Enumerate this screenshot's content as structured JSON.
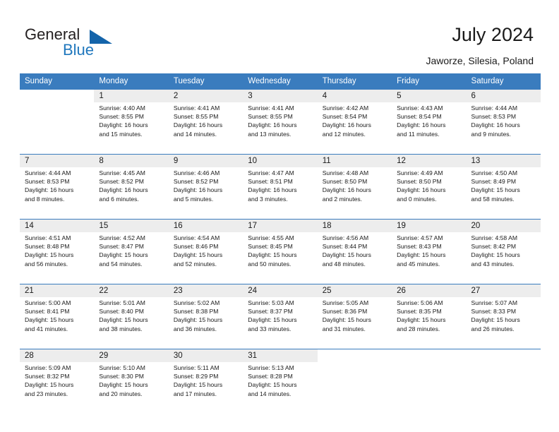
{
  "brand": {
    "name_top": "General",
    "name_bottom": "Blue",
    "accent_color": "#1f77bd",
    "triangle_color": "#1464aa"
  },
  "header": {
    "title": "July 2024",
    "subtitle": "Jaworze, Silesia, Poland"
  },
  "calendar": {
    "header_bg": "#3a7cbe",
    "daynum_bg": "#ededed",
    "columns": [
      "Sunday",
      "Monday",
      "Tuesday",
      "Wednesday",
      "Thursday",
      "Friday",
      "Saturday"
    ],
    "weeks": [
      [
        {
          "day": "",
          "sunrise": "",
          "sunset": "",
          "daylight_line1": "",
          "daylight_line2": ""
        },
        {
          "day": "1",
          "sunrise": "Sunrise: 4:40 AM",
          "sunset": "Sunset: 8:55 PM",
          "daylight_line1": "Daylight: 16 hours",
          "daylight_line2": "and 15 minutes."
        },
        {
          "day": "2",
          "sunrise": "Sunrise: 4:41 AM",
          "sunset": "Sunset: 8:55 PM",
          "daylight_line1": "Daylight: 16 hours",
          "daylight_line2": "and 14 minutes."
        },
        {
          "day": "3",
          "sunrise": "Sunrise: 4:41 AM",
          "sunset": "Sunset: 8:55 PM",
          "daylight_line1": "Daylight: 16 hours",
          "daylight_line2": "and 13 minutes."
        },
        {
          "day": "4",
          "sunrise": "Sunrise: 4:42 AM",
          "sunset": "Sunset: 8:54 PM",
          "daylight_line1": "Daylight: 16 hours",
          "daylight_line2": "and 12 minutes."
        },
        {
          "day": "5",
          "sunrise": "Sunrise: 4:43 AM",
          "sunset": "Sunset: 8:54 PM",
          "daylight_line1": "Daylight: 16 hours",
          "daylight_line2": "and 11 minutes."
        },
        {
          "day": "6",
          "sunrise": "Sunrise: 4:44 AM",
          "sunset": "Sunset: 8:53 PM",
          "daylight_line1": "Daylight: 16 hours",
          "daylight_line2": "and 9 minutes."
        }
      ],
      [
        {
          "day": "7",
          "sunrise": "Sunrise: 4:44 AM",
          "sunset": "Sunset: 8:53 PM",
          "daylight_line1": "Daylight: 16 hours",
          "daylight_line2": "and 8 minutes."
        },
        {
          "day": "8",
          "sunrise": "Sunrise: 4:45 AM",
          "sunset": "Sunset: 8:52 PM",
          "daylight_line1": "Daylight: 16 hours",
          "daylight_line2": "and 6 minutes."
        },
        {
          "day": "9",
          "sunrise": "Sunrise: 4:46 AM",
          "sunset": "Sunset: 8:52 PM",
          "daylight_line1": "Daylight: 16 hours",
          "daylight_line2": "and 5 minutes."
        },
        {
          "day": "10",
          "sunrise": "Sunrise: 4:47 AM",
          "sunset": "Sunset: 8:51 PM",
          "daylight_line1": "Daylight: 16 hours",
          "daylight_line2": "and 3 minutes."
        },
        {
          "day": "11",
          "sunrise": "Sunrise: 4:48 AM",
          "sunset": "Sunset: 8:50 PM",
          "daylight_line1": "Daylight: 16 hours",
          "daylight_line2": "and 2 minutes."
        },
        {
          "day": "12",
          "sunrise": "Sunrise: 4:49 AM",
          "sunset": "Sunset: 8:50 PM",
          "daylight_line1": "Daylight: 16 hours",
          "daylight_line2": "and 0 minutes."
        },
        {
          "day": "13",
          "sunrise": "Sunrise: 4:50 AM",
          "sunset": "Sunset: 8:49 PM",
          "daylight_line1": "Daylight: 15 hours",
          "daylight_line2": "and 58 minutes."
        }
      ],
      [
        {
          "day": "14",
          "sunrise": "Sunrise: 4:51 AM",
          "sunset": "Sunset: 8:48 PM",
          "daylight_line1": "Daylight: 15 hours",
          "daylight_line2": "and 56 minutes."
        },
        {
          "day": "15",
          "sunrise": "Sunrise: 4:52 AM",
          "sunset": "Sunset: 8:47 PM",
          "daylight_line1": "Daylight: 15 hours",
          "daylight_line2": "and 54 minutes."
        },
        {
          "day": "16",
          "sunrise": "Sunrise: 4:54 AM",
          "sunset": "Sunset: 8:46 PM",
          "daylight_line1": "Daylight: 15 hours",
          "daylight_line2": "and 52 minutes."
        },
        {
          "day": "17",
          "sunrise": "Sunrise: 4:55 AM",
          "sunset": "Sunset: 8:45 PM",
          "daylight_line1": "Daylight: 15 hours",
          "daylight_line2": "and 50 minutes."
        },
        {
          "day": "18",
          "sunrise": "Sunrise: 4:56 AM",
          "sunset": "Sunset: 8:44 PM",
          "daylight_line1": "Daylight: 15 hours",
          "daylight_line2": "and 48 minutes."
        },
        {
          "day": "19",
          "sunrise": "Sunrise: 4:57 AM",
          "sunset": "Sunset: 8:43 PM",
          "daylight_line1": "Daylight: 15 hours",
          "daylight_line2": "and 45 minutes."
        },
        {
          "day": "20",
          "sunrise": "Sunrise: 4:58 AM",
          "sunset": "Sunset: 8:42 PM",
          "daylight_line1": "Daylight: 15 hours",
          "daylight_line2": "and 43 minutes."
        }
      ],
      [
        {
          "day": "21",
          "sunrise": "Sunrise: 5:00 AM",
          "sunset": "Sunset: 8:41 PM",
          "daylight_line1": "Daylight: 15 hours",
          "daylight_line2": "and 41 minutes."
        },
        {
          "day": "22",
          "sunrise": "Sunrise: 5:01 AM",
          "sunset": "Sunset: 8:40 PM",
          "daylight_line1": "Daylight: 15 hours",
          "daylight_line2": "and 38 minutes."
        },
        {
          "day": "23",
          "sunrise": "Sunrise: 5:02 AM",
          "sunset": "Sunset: 8:38 PM",
          "daylight_line1": "Daylight: 15 hours",
          "daylight_line2": "and 36 minutes."
        },
        {
          "day": "24",
          "sunrise": "Sunrise: 5:03 AM",
          "sunset": "Sunset: 8:37 PM",
          "daylight_line1": "Daylight: 15 hours",
          "daylight_line2": "and 33 minutes."
        },
        {
          "day": "25",
          "sunrise": "Sunrise: 5:05 AM",
          "sunset": "Sunset: 8:36 PM",
          "daylight_line1": "Daylight: 15 hours",
          "daylight_line2": "and 31 minutes."
        },
        {
          "day": "26",
          "sunrise": "Sunrise: 5:06 AM",
          "sunset": "Sunset: 8:35 PM",
          "daylight_line1": "Daylight: 15 hours",
          "daylight_line2": "and 28 minutes."
        },
        {
          "day": "27",
          "sunrise": "Sunrise: 5:07 AM",
          "sunset": "Sunset: 8:33 PM",
          "daylight_line1": "Daylight: 15 hours",
          "daylight_line2": "and 26 minutes."
        }
      ],
      [
        {
          "day": "28",
          "sunrise": "Sunrise: 5:09 AM",
          "sunset": "Sunset: 8:32 PM",
          "daylight_line1": "Daylight: 15 hours",
          "daylight_line2": "and 23 minutes."
        },
        {
          "day": "29",
          "sunrise": "Sunrise: 5:10 AM",
          "sunset": "Sunset: 8:30 PM",
          "daylight_line1": "Daylight: 15 hours",
          "daylight_line2": "and 20 minutes."
        },
        {
          "day": "30",
          "sunrise": "Sunrise: 5:11 AM",
          "sunset": "Sunset: 8:29 PM",
          "daylight_line1": "Daylight: 15 hours",
          "daylight_line2": "and 17 minutes."
        },
        {
          "day": "31",
          "sunrise": "Sunrise: 5:13 AM",
          "sunset": "Sunset: 8:28 PM",
          "daylight_line1": "Daylight: 15 hours",
          "daylight_line2": "and 14 minutes."
        },
        {
          "day": "",
          "sunrise": "",
          "sunset": "",
          "daylight_line1": "",
          "daylight_line2": ""
        },
        {
          "day": "",
          "sunrise": "",
          "sunset": "",
          "daylight_line1": "",
          "daylight_line2": ""
        },
        {
          "day": "",
          "sunrise": "",
          "sunset": "",
          "daylight_line1": "",
          "daylight_line2": ""
        }
      ]
    ]
  }
}
